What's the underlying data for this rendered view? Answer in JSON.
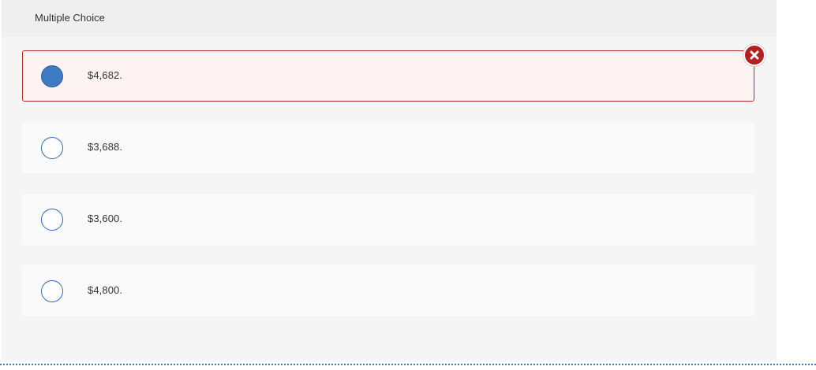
{
  "question": {
    "type_label": "Multiple Choice"
  },
  "options": [
    {
      "label": "$4,682.",
      "selected": true,
      "status": "incorrect"
    },
    {
      "label": "$3,688.",
      "selected": false
    },
    {
      "label": "$3,600.",
      "selected": false
    },
    {
      "label": "$4,800.",
      "selected": false
    }
  ],
  "colors": {
    "incorrect_border": "#b22b2b",
    "incorrect_background": "#fdf3f3",
    "incorrect_badge": "#b41f1f",
    "radio_selected": "#3e7bc4",
    "radio_border": "#2e6bb0"
  },
  "icons": {
    "incorrect_marker": "close-circle-icon"
  }
}
